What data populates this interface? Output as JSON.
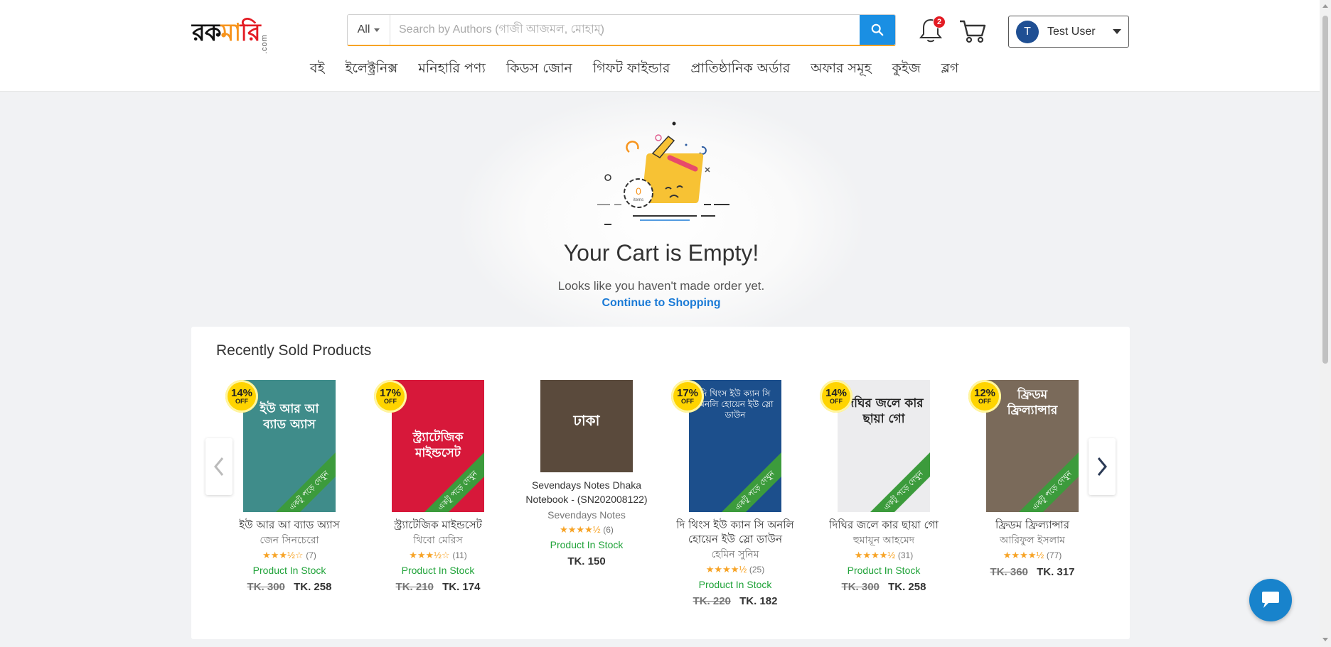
{
  "header": {
    "logo": {
      "text_part1": "রক",
      "text_part2": "মা",
      "text_part3": "রি",
      "suffix": ".com"
    },
    "search": {
      "category": "All",
      "placeholder": "Search by Authors (গাজী আজমল, মোহাম্)"
    },
    "notifications": {
      "count": "2"
    },
    "user": {
      "initial": "T",
      "name": "Test User"
    }
  },
  "nav": {
    "items": [
      {
        "label": "বই"
      },
      {
        "label": "ইলেক্ট্রনিক্স"
      },
      {
        "label": "মনিহারি পণ্য"
      },
      {
        "label": "কিডস জোন"
      },
      {
        "label": "গিফট ফাইন্ডার"
      },
      {
        "label": "প্রাতিষ্ঠানিক অর্ডার"
      },
      {
        "label": "অফার সমূহ"
      },
      {
        "label": "কুইজ"
      },
      {
        "label": "ব্লগ"
      }
    ]
  },
  "empty_cart": {
    "badge_count": "0",
    "badge_label": "items",
    "title": "Your Cart is Empty!",
    "subtitle": "Looks like you haven't made order yet.",
    "link": "Continue to Shopping"
  },
  "recent": {
    "title": "Recently Sold Products",
    "ribbon_text": "একটু পড়ে দেখুন",
    "products": [
      {
        "discount": "14%",
        "off": "OFF",
        "cover_title": "ইউ আর আ ব্যাড অ্যাস",
        "cover_color": "#3f8c8a",
        "name": "ইউ আর আ ব্যাড অ্যাস",
        "author": "জেন সিনচেরো",
        "stars": "★★★½☆",
        "rating_count": "(7)",
        "stock": "Product In Stock",
        "old_price": "TK. 300",
        "price": "TK. 258"
      },
      {
        "discount": "17%",
        "off": "OFF",
        "cover_title": "স্ট্র্যাটেজিক মাইন্ডসেট",
        "cover_color": "#d7183a",
        "name": "স্ট্র্যাটেজিক মাইন্ডসেট",
        "author": "থিবো মেরিস",
        "stars": "★★★½☆",
        "rating_count": "(11)",
        "stock": "Product In Stock",
        "old_price": "TK. 210",
        "price": "TK. 174"
      },
      {
        "cover_title": "ঢাকা",
        "cover_color": "#5a4a3c",
        "name": "Sevendays Notes Dhaka Notebook - (SN202008122)",
        "author": "Sevendays Notes",
        "stars": "★★★★½",
        "rating_count": "(6)",
        "stock": "Product In Stock",
        "price": "TK. 150"
      },
      {
        "discount": "17%",
        "off": "OFF",
        "cover_title": "দি থিংস ইউ ক্যান সি অনলি হোয়েন ইউ স্লো ডাউন",
        "cover_color": "#1c4f8c",
        "name": "দি থিংস ইউ ক্যান সি অনলি হোয়েন ইউ স্লো ডাউন",
        "author": "হেমিন সুনিম",
        "stars": "★★★★½",
        "rating_count": "(25)",
        "stock": "Product In Stock",
        "old_price": "TK. 220",
        "price": "TK. 182"
      },
      {
        "discount": "14%",
        "off": "OFF",
        "cover_title": "দিঘির জলে কার ছায়া গো",
        "cover_color": "#e8e8ea",
        "name": "দিঘির জলে কার ছায়া গো",
        "author": "হুমায়ূন আহমেদ",
        "stars": "★★★★½",
        "rating_count": "(31)",
        "stock": "Product In Stock",
        "old_price": "TK. 300",
        "price": "TK. 258"
      },
      {
        "discount": "12%",
        "off": "OFF",
        "cover_title": "ফ্রিডম ফ্রিল্যান্সার",
        "cover_color": "#7a6a5a",
        "name": "ফ্রিডম ফ্রিল্যান্সার",
        "author": "আরিফুল ইসলাম",
        "stars": "★★★★½",
        "rating_count": "(77)",
        "old_price": "TK. 360",
        "price": "TK. 317"
      }
    ]
  },
  "colors": {
    "accent": "#1a8fe3",
    "link": "#1a7ad6",
    "stock": "#21a33a",
    "star": "#f7a325",
    "discount": "#ffd400",
    "ribbon": "#3c9b3c",
    "badge": "#e31b23"
  }
}
